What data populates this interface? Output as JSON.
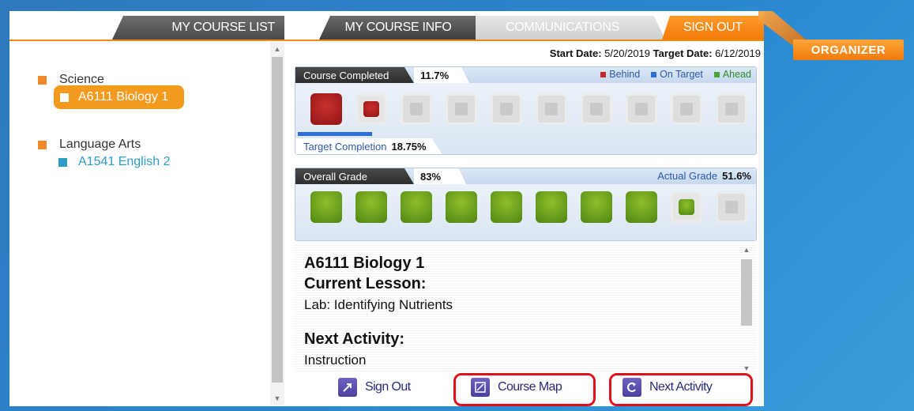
{
  "tabs": {
    "course_list": "MY COURSE LIST",
    "course_info": "MY COURSE INFO",
    "communications": "COMMUNICATIONS",
    "sign_out": "SIGN OUT"
  },
  "organizer": "ORGANIZER",
  "sidebar": {
    "groups": [
      {
        "label": "Science",
        "color": "#f0892a",
        "courses": [
          {
            "label": "A6111 Biology 1",
            "active": true
          }
        ]
      },
      {
        "label": "Language Arts",
        "color": "#f0892a",
        "courses": [
          {
            "label": "A1541 English 2",
            "active": false,
            "color": "#2d9bc7"
          }
        ]
      }
    ]
  },
  "dates": {
    "start_label": "Start Date:",
    "start_value": "5/20/2019",
    "target_label": "Target Date:",
    "target_value": "6/12/2019"
  },
  "course_completed": {
    "label": "Course Completed",
    "percent": "11.7%",
    "legend": [
      {
        "label": "Behind",
        "color": "#c0282a"
      },
      {
        "label": "On Target",
        "color": "#2e6fd6"
      },
      {
        "label": "Ahead",
        "color": "#4fa13a"
      }
    ],
    "target_label": "Target Completion",
    "target_percent": "18.75%"
  },
  "overall_grade": {
    "label": "Overall Grade",
    "percent": "83%",
    "actual_label": "Actual Grade",
    "actual_percent": "51.6%"
  },
  "info": {
    "course_title": "A6111 Biology 1",
    "current_lesson_heading": "Current Lesson:",
    "current_lesson": "Lab: Identifying Nutrients",
    "next_activity_heading": "Next Activity:",
    "next_activity": "Instruction"
  },
  "footer": {
    "sign_out": "Sign Out",
    "course_map": "Course Map",
    "next_activity": "Next Activity"
  },
  "colors": {
    "accent_orange": "#f28a17",
    "brand_blue": "#2a87cf",
    "highlight_red": "#e0101a"
  }
}
